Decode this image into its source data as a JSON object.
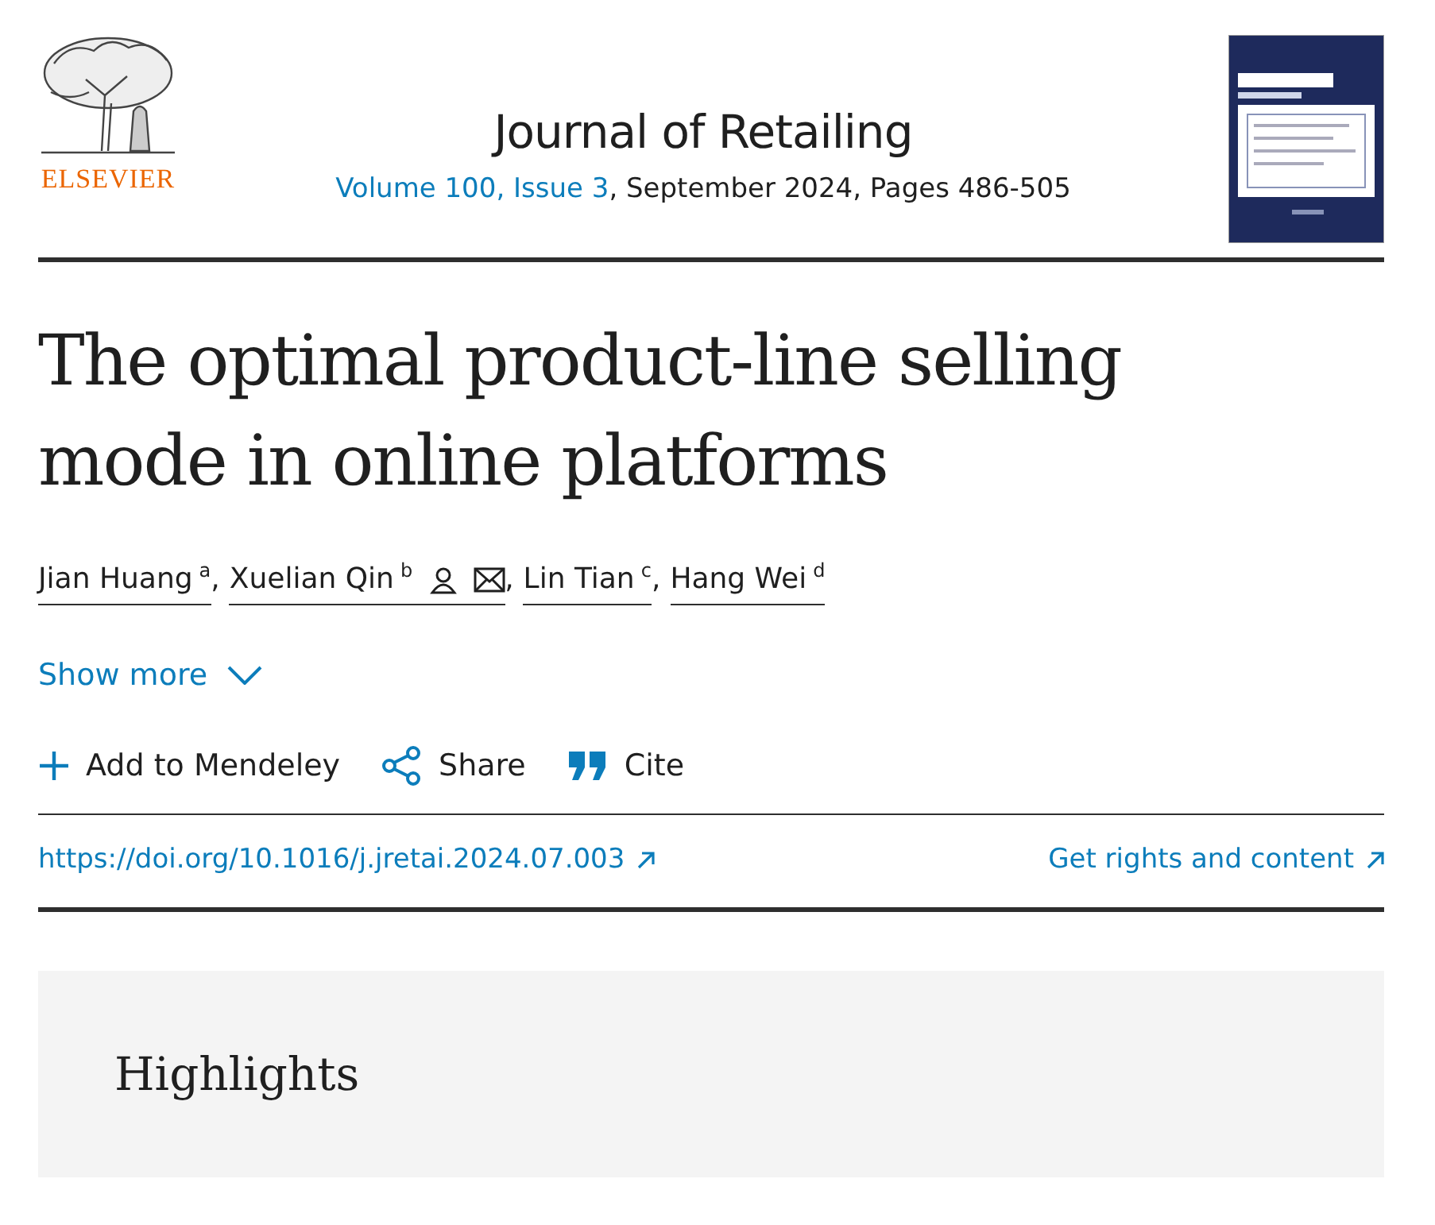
{
  "publisher": {
    "name": "ELSEVIER"
  },
  "journal": {
    "title": "Journal of Retailing",
    "volume": "Volume 100, Issue 3",
    "details": ", September 2024, Pages 486-505"
  },
  "article": {
    "title": "The optimal product-line selling mode in online platforms"
  },
  "authors": [
    {
      "name": "Jian Huang",
      "affiliation": "a",
      "corresponding": false
    },
    {
      "name": "Xuelian Qin",
      "affiliation": "b",
      "corresponding": true
    },
    {
      "name": "Lin Tian",
      "affiliation": "c",
      "corresponding": false
    },
    {
      "name": "Hang Wei",
      "affiliation": "d",
      "corresponding": false
    }
  ],
  "author_separator": ",",
  "show_more": {
    "label": "Show more",
    "expanded": false
  },
  "actions": [
    {
      "kind": "add",
      "label": "Add to Mendeley"
    },
    {
      "kind": "share",
      "label": "Share"
    },
    {
      "kind": "cite",
      "label": "Cite"
    }
  ],
  "doi": {
    "label": "https://doi.org/10.1016/j.jretai.2024.07.003"
  },
  "rights": {
    "label": "Get rights and content"
  },
  "highlights": {
    "heading": "Highlights"
  }
}
